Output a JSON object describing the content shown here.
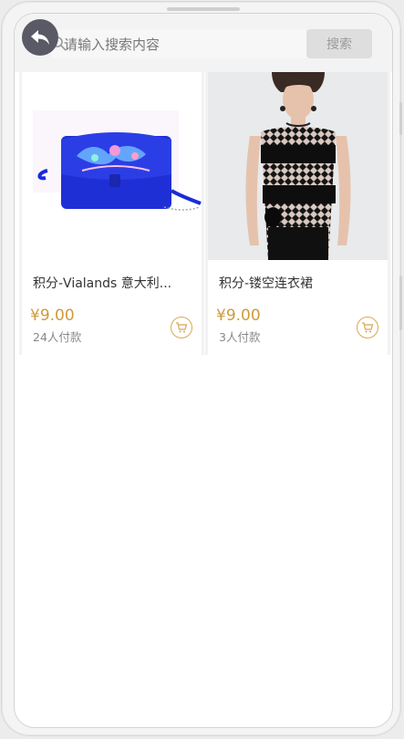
{
  "search": {
    "placeholder": "请输入搜索内容",
    "button_label": "搜索"
  },
  "products": [
    {
      "title": "积分-Vialands 意大利...",
      "price": "¥9.00",
      "sales": "24人付款",
      "image_icon": "embroidered-handbag-image"
    },
    {
      "title": "积分-镂空连衣裙",
      "price": "¥9.00",
      "sales": "3人付款",
      "image_icon": "lace-dress-model-image"
    }
  ],
  "colors": {
    "price": "#d09a3a",
    "cart_outline": "#d8a850",
    "back_button": "#5a5a66"
  }
}
